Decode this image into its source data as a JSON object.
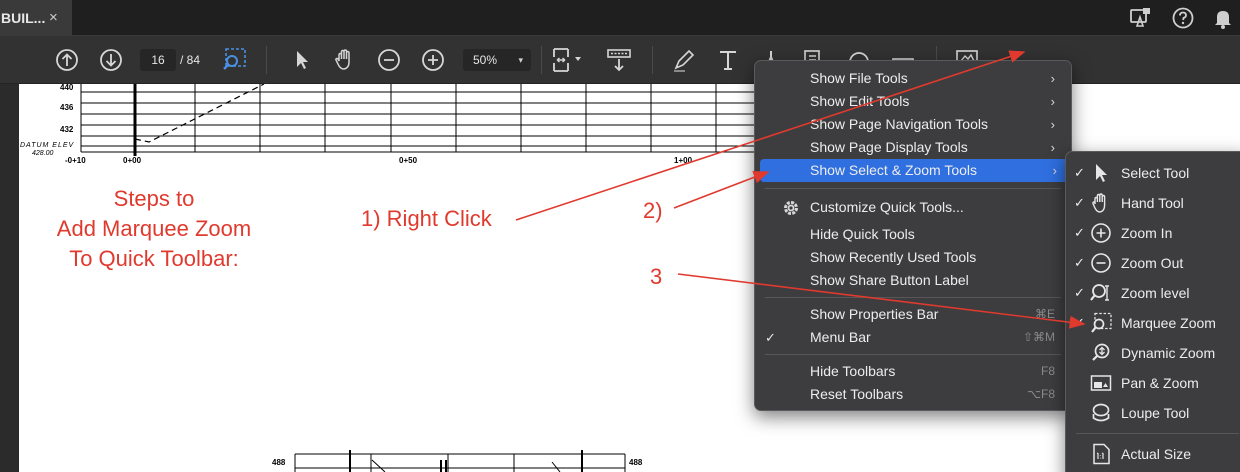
{
  "tab": {
    "title": "BUIL...",
    "close": "×"
  },
  "toolbar": {
    "page_current": "16",
    "page_total": "/ 84",
    "zoom": "50%",
    "zoom_caret": "▾"
  },
  "drawing": {
    "elevations": [
      "440",
      "436",
      "432"
    ],
    "datum_label": "DATUM ELEV",
    "datum_value": "428.00",
    "stations": [
      "-0+10",
      "0+00",
      "0+50",
      "1+00"
    ],
    "lower_elevation": "488"
  },
  "annotations": {
    "steps_title": [
      "Steps to",
      "Add Marquee Zoom",
      "To Quick Toolbar:"
    ],
    "step1": "1) Right Click",
    "step2": "2)",
    "step3": "3"
  },
  "context_menu": {
    "items": [
      {
        "label": "Show File Tools",
        "arrow": "›"
      },
      {
        "label": "Show Edit Tools",
        "arrow": "›"
      },
      {
        "label": "Show Page Navigation Tools",
        "arrow": "›"
      },
      {
        "label": "Show Page Display Tools",
        "arrow": "›"
      },
      {
        "label": "Show Select & Zoom Tools",
        "arrow": "›"
      },
      {
        "label": "Customize Quick Tools..."
      },
      {
        "label": "Hide Quick Tools"
      },
      {
        "label": "Show Recently Used Tools"
      },
      {
        "label": "Show Share Button Label"
      },
      {
        "label": "Show Properties Bar",
        "shortcut": "⌘E"
      },
      {
        "label": "Menu Bar",
        "shortcut": "⇧⌘M",
        "check": "✓"
      },
      {
        "label": "Hide Toolbars",
        "shortcut": "F8"
      },
      {
        "label": "Reset Toolbars",
        "shortcut": "⌥F8"
      }
    ]
  },
  "submenu": {
    "items": [
      {
        "label": "Select Tool",
        "check": "✓",
        "icon": "pointer-icon"
      },
      {
        "label": "Hand Tool",
        "check": "✓",
        "icon": "hand-icon"
      },
      {
        "label": "Zoom In",
        "check": "✓",
        "icon": "plus-circle-icon"
      },
      {
        "label": "Zoom Out",
        "check": "✓",
        "icon": "minus-circle-icon"
      },
      {
        "label": "Zoom level",
        "check": "✓",
        "icon": "zoom-level-icon"
      },
      {
        "label": "Marquee Zoom",
        "check": "✓",
        "icon": "marquee-zoom-icon"
      },
      {
        "label": "Dynamic Zoom",
        "icon": "dynamic-zoom-icon"
      },
      {
        "label": "Pan & Zoom",
        "icon": "pan-zoom-icon"
      },
      {
        "label": "Loupe Tool",
        "icon": "loupe-icon"
      },
      {
        "label": "Actual Size",
        "icon": "actual-size-icon"
      }
    ]
  },
  "colors": {
    "accent": "#2f6fe0",
    "annotation": "#e03a2e",
    "active_tool": "#4a90e2"
  }
}
